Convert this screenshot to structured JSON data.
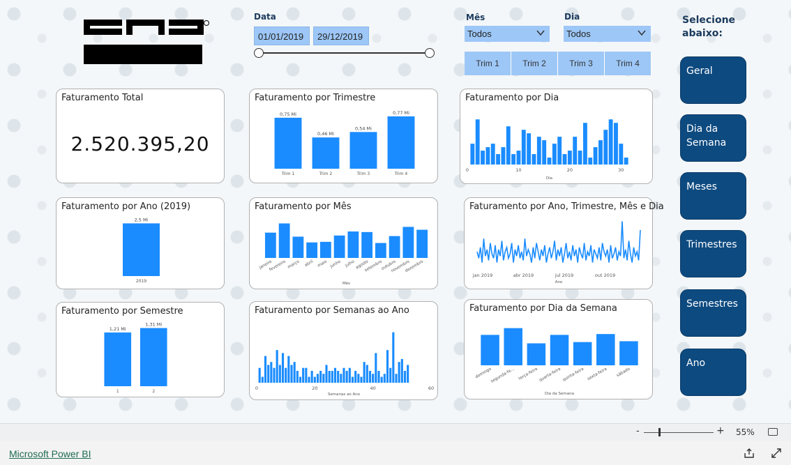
{
  "filters": {
    "data_label": "Data",
    "date_start": "01/01/2019",
    "date_end": "29/12/2019",
    "mes_label": "Mês",
    "mes_value": "Todos",
    "dia_label": "Dia",
    "dia_value": "Todos",
    "trims": [
      "Trim 1",
      "Trim 2",
      "Trim 3",
      "Trim 4"
    ]
  },
  "nav": {
    "title": "Selecione abaixo:",
    "buttons": [
      "Geral",
      "Dia da Semana",
      "Meses",
      "Trimestres",
      "Semestres",
      "Ano"
    ]
  },
  "cards": {
    "total_title": "Faturamento Total",
    "total_value": "2.520.395,20",
    "ano_title": "Faturamento por Ano (2019)",
    "semestre_title": "Faturamento por Semestre",
    "trimestre_title": "Faturamento por Trimestre",
    "mes_title": "Faturamento por Mês",
    "semanas_title": "Faturamento por Semanas ao Ano",
    "dia_title": "Faturamento por Dia",
    "ano_tri_title": "Faturamento por Ano, Trimestre, Mês e Dia",
    "dia_semana_title": "Faturamento por Dia da Semana"
  },
  "statusbar": {
    "zoom_minus": "-",
    "zoom_plus": "+",
    "zoom": "55%"
  },
  "footer": {
    "link": "Microsoft Power BI"
  },
  "colors": {
    "bar": "#1a8cff",
    "nav": "#0d4a80",
    "slicer": "#9dc7f7"
  },
  "chart_data": [
    {
      "id": "ano",
      "type": "bar",
      "categories": [
        "2019"
      ],
      "values": [
        2.52
      ],
      "data_labels": [
        "2,5 Mi"
      ],
      "ylim": [
        0,
        2.6
      ]
    },
    {
      "id": "semestre",
      "type": "bar",
      "categories": [
        "1",
        "2"
      ],
      "values": [
        1.21,
        1.31
      ],
      "data_labels": [
        "1,21 Mi",
        "1,31 Mi"
      ],
      "ylim": [
        0,
        1.35
      ]
    },
    {
      "id": "trimestre",
      "type": "bar",
      "categories": [
        "Trim 1",
        "Trim 2",
        "Trim 3",
        "Trim 4"
      ],
      "values": [
        0.75,
        0.46,
        0.54,
        0.77
      ],
      "data_labels": [
        "0,75 Mi",
        "0,46 Mi",
        "0,54 Mi",
        "0,77 Mi"
      ],
      "ylim": [
        0,
        0.8
      ]
    },
    {
      "id": "mes",
      "type": "bar",
      "categories": [
        "janeiro",
        "fevereiro",
        "março",
        "abril",
        "maio",
        "junho",
        "julho",
        "agosto",
        "setembro",
        "outubro",
        "novembro",
        "dezembro"
      ],
      "values": [
        220,
        300,
        185,
        135,
        140,
        195,
        230,
        225,
        130,
        190,
        270,
        245
      ],
      "xlabel": "Mês"
    },
    {
      "id": "semanas",
      "type": "bar",
      "x": [
        1,
        2,
        3,
        4,
        5,
        6,
        7,
        8,
        9,
        10,
        11,
        12,
        13,
        14,
        15,
        16,
        17,
        18,
        19,
        20,
        21,
        22,
        23,
        24,
        25,
        26,
        27,
        28,
        29,
        30,
        31,
        32,
        33,
        34,
        35,
        36,
        37,
        38,
        39,
        40,
        41,
        42,
        43,
        44,
        45,
        46,
        47,
        48,
        49,
        50,
        51,
        52
      ],
      "values": [
        25,
        10,
        45,
        30,
        35,
        25,
        55,
        30,
        50,
        25,
        45,
        30,
        35,
        20,
        10,
        25,
        25,
        10,
        20,
        10,
        15,
        20,
        15,
        30,
        20,
        20,
        25,
        20,
        15,
        25,
        20,
        25,
        10,
        20,
        15,
        10,
        35,
        30,
        20,
        15,
        50,
        20,
        10,
        15,
        55,
        25,
        85,
        15,
        35,
        40,
        20,
        30
      ],
      "xticks": [
        0,
        20,
        40,
        60
      ],
      "xlim": [
        0,
        60
      ],
      "xlabel": "Semanas ao Ano"
    },
    {
      "id": "dia",
      "type": "bar",
      "x": [
        1,
        2,
        3,
        4,
        5,
        6,
        7,
        8,
        9,
        10,
        11,
        12,
        13,
        14,
        15,
        16,
        17,
        18,
        19,
        20,
        21,
        22,
        23,
        24,
        25,
        26,
        27,
        28,
        29,
        30,
        31
      ],
      "values": [
        30,
        65,
        20,
        25,
        30,
        15,
        25,
        55,
        15,
        20,
        50,
        45,
        15,
        40,
        35,
        10,
        30,
        40,
        15,
        20,
        40,
        20,
        60,
        10,
        25,
        35,
        50,
        65,
        60,
        30,
        10
      ],
      "xticks": [
        0,
        10,
        20,
        30
      ],
      "xlim": [
        0,
        32
      ],
      "xlabel": "Dia"
    },
    {
      "id": "ano_tri",
      "type": "line",
      "xticks": [
        "jan 2019",
        "abr 2019",
        "jul 2019",
        "out 2019"
      ],
      "xlabel": "Ano",
      "values": [
        8,
        5,
        10,
        3,
        14,
        6,
        9,
        4,
        12,
        7,
        5,
        11,
        3,
        9,
        6,
        13,
        4,
        8,
        10,
        5,
        7,
        12,
        3,
        9,
        6,
        11,
        5,
        8,
        4,
        14,
        6,
        9,
        7,
        3,
        10,
        5,
        12,
        8,
        4,
        9,
        6,
        11,
        3,
        7,
        10,
        5,
        8,
        13,
        4,
        9,
        6,
        10,
        3,
        7,
        12,
        5,
        8,
        4,
        11,
        6,
        9,
        3,
        10,
        7,
        5,
        12,
        4,
        8,
        6,
        11,
        3,
        9,
        7,
        5,
        10,
        4,
        12,
        8,
        6,
        9,
        3,
        11,
        5,
        7,
        10,
        4,
        8,
        6,
        22,
        5,
        9,
        4,
        13,
        7,
        3,
        10,
        6,
        8,
        4,
        18
      ]
    },
    {
      "id": "dia_semana",
      "type": "bar",
      "categories": [
        "domingo",
        "segunda-fe...",
        "terça-feira",
        "quarta-feira",
        "quinta-feira",
        "sexta-feira",
        "sábado"
      ],
      "values": [
        360,
        440,
        260,
        360,
        275,
        370,
        285
      ],
      "xlabel": "Dia da Semana"
    }
  ]
}
